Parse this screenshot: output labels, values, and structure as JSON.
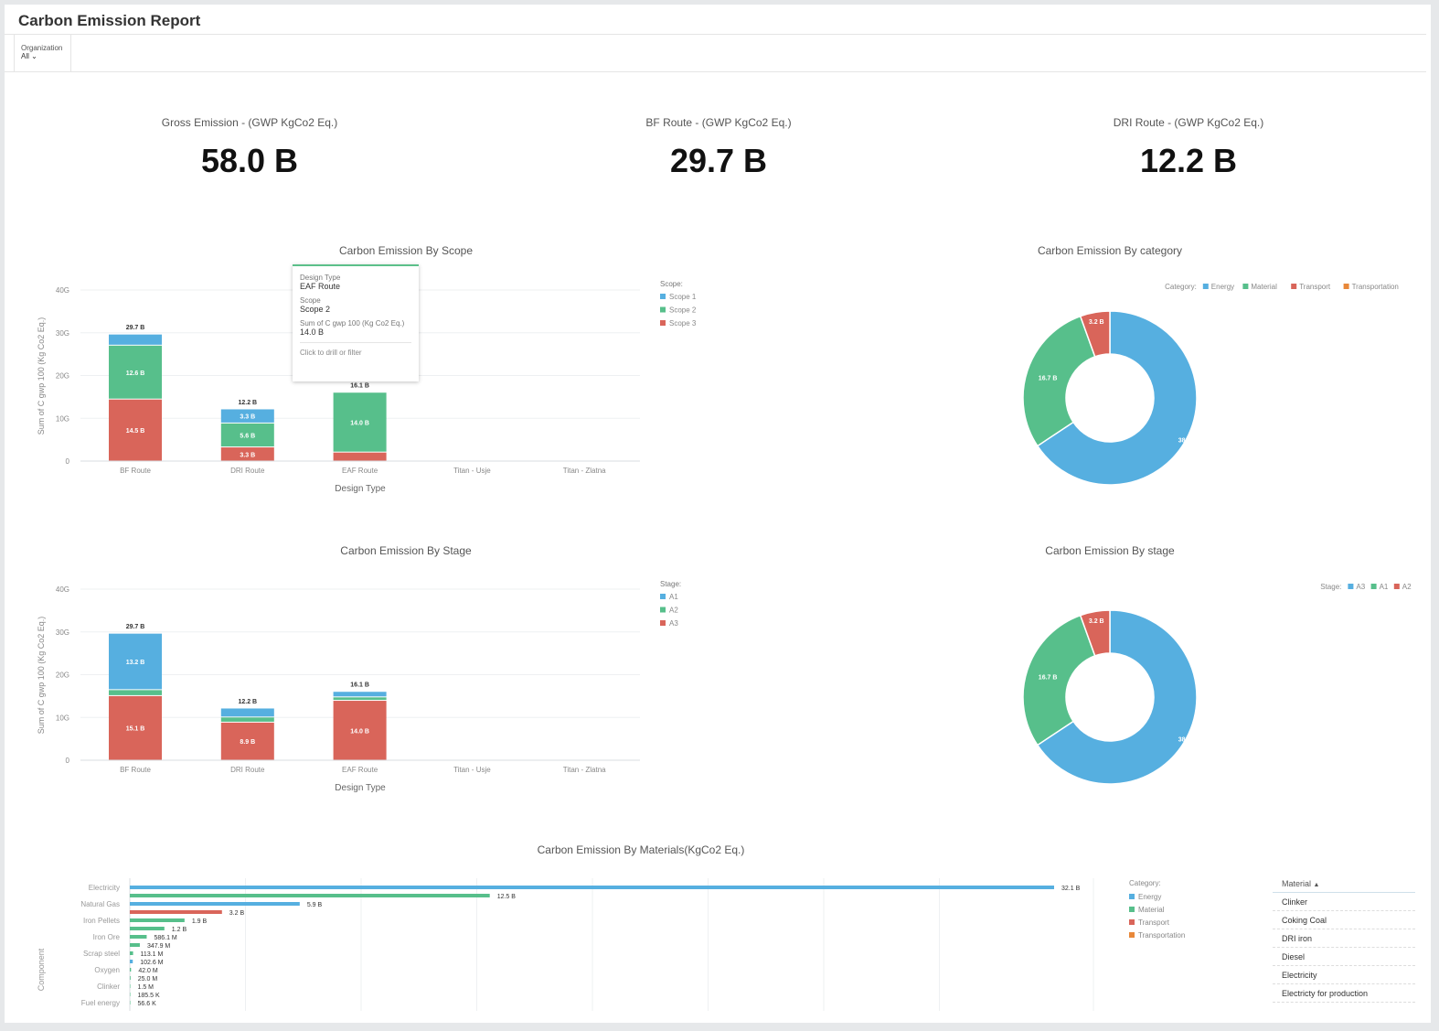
{
  "header": {
    "title": "Carbon Emission Report"
  },
  "filter": {
    "label": "Organization",
    "value": "All"
  },
  "kpis": [
    {
      "label": "Gross Emission - (GWP KgCo2 Eq.)",
      "value": "58.0 B"
    },
    {
      "label": "BF Route - (GWP KgCo2 Eq.)",
      "value": "29.7 B"
    },
    {
      "label": "DRI Route - (GWP KgCo2 Eq.)",
      "value": "12.2 B"
    }
  ],
  "colors": {
    "blue": "#56afe0",
    "green": "#57bf8b",
    "red": "#d9655a",
    "orange": "#e8883a"
  },
  "tooltip": {
    "k1": "Design Type",
    "v1": "EAF Route",
    "k2": "Scope",
    "v2": "Scope 2",
    "k3": "Sum of C gwp 100 (Kg Co2 Eq.)",
    "v3": "14.0 B",
    "footer": "Click to drill or filter"
  },
  "chart_data": [
    {
      "type": "bar",
      "stacked": true,
      "title": "Carbon Emission By Scope",
      "xlabel": "Design Type",
      "ylabel": "Sum of C gwp 100 (Kg Co2 Eq.)",
      "ylim": [
        0,
        40
      ],
      "yticks": [
        "0",
        "10G",
        "20G",
        "30G",
        "40G"
      ],
      "categories": [
        "BF Route",
        "DRI Route",
        "EAF Route",
        "Titan - Usje",
        "Titan - Zlatna"
      ],
      "legend_title": "Scope:",
      "totals": [
        "29.7 B",
        "12.2 B",
        "16.1 B",
        "",
        ""
      ],
      "series": [
        {
          "name": "Scope 3",
          "color": "red",
          "values": [
            14.5,
            3.3,
            2.1,
            0,
            0
          ],
          "labels": [
            "14.5 B",
            "3.3 B",
            "",
            "",
            ""
          ]
        },
        {
          "name": "Scope 2",
          "color": "green",
          "values": [
            12.6,
            5.6,
            14.0,
            0,
            0
          ],
          "labels": [
            "12.6 B",
            "5.6 B",
            "14.0 B",
            "",
            ""
          ]
        },
        {
          "name": "Scope 1",
          "color": "blue",
          "values": [
            2.6,
            3.3,
            0,
            0,
            0
          ],
          "labels": [
            "",
            "3.3 B",
            "",
            "",
            ""
          ]
        }
      ],
      "legend_order": [
        "Scope 1",
        "Scope 2",
        "Scope 3"
      ]
    },
    {
      "type": "pie",
      "donut": true,
      "title": "Carbon Emission By category",
      "legend_title": "Category:",
      "legend": [
        {
          "name": "Energy",
          "color": "blue"
        },
        {
          "name": "Material",
          "color": "green"
        },
        {
          "name": "Transport",
          "color": "red"
        },
        {
          "name": "Transportation",
          "color": "orange"
        }
      ],
      "slices": [
        {
          "name": "Energy",
          "value": 38.1,
          "label": "38.1 B",
          "color": "blue"
        },
        {
          "name": "Material",
          "value": 16.7,
          "label": "16.7 B",
          "color": "green"
        },
        {
          "name": "Transport",
          "value": 3.2,
          "label": "3.2 B",
          "color": "red"
        }
      ]
    },
    {
      "type": "bar",
      "stacked": true,
      "title": "Carbon Emission By Stage",
      "xlabel": "Design Type",
      "ylabel": "Sum of C gwp 100 (Kg Co2 Eq.)",
      "ylim": [
        0,
        40
      ],
      "yticks": [
        "0",
        "10G",
        "20G",
        "30G",
        "40G"
      ],
      "categories": [
        "BF Route",
        "DRI Route",
        "EAF Route",
        "Titan - Usje",
        "Titan - Zlatna"
      ],
      "legend_title": "Stage:",
      "totals": [
        "29.7 B",
        "12.2 B",
        "16.1 B",
        "",
        ""
      ],
      "series": [
        {
          "name": "A3",
          "color": "red",
          "values": [
            15.1,
            8.9,
            14.0,
            0,
            0
          ],
          "labels": [
            "15.1 B",
            "8.9 B",
            "14.0 B",
            "",
            ""
          ]
        },
        {
          "name": "A2",
          "color": "green",
          "values": [
            1.4,
            1.2,
            0.8,
            0,
            0
          ],
          "labels": [
            "",
            "",
            "",
            "",
            ""
          ]
        },
        {
          "name": "A1",
          "color": "blue",
          "values": [
            13.2,
            2.1,
            1.3,
            0,
            0
          ],
          "labels": [
            "13.2 B",
            "",
            "",
            "",
            ""
          ]
        }
      ],
      "legend_order": [
        "A1",
        "A2",
        "A3"
      ]
    },
    {
      "type": "pie",
      "donut": true,
      "title": "Carbon Emission By stage",
      "legend_title": "Stage:",
      "legend": [
        {
          "name": "A3",
          "color": "blue"
        },
        {
          "name": "A1",
          "color": "green"
        },
        {
          "name": "A2",
          "color": "red"
        }
      ],
      "slices": [
        {
          "name": "A3",
          "value": 38.1,
          "label": "38.1 B",
          "color": "blue"
        },
        {
          "name": "A1",
          "value": 16.7,
          "label": "16.7 B",
          "color": "green"
        },
        {
          "name": "A2",
          "value": 3.2,
          "label": "3.2 B",
          "color": "red"
        }
      ]
    },
    {
      "type": "bar",
      "horizontal": true,
      "title": "Carbon Emission By Materials(KgCo2 Eq.)",
      "ylabel": "Component",
      "legend_title": "Category:",
      "legend": [
        {
          "name": "Energy",
          "color": "blue"
        },
        {
          "name": "Material",
          "color": "green"
        },
        {
          "name": "Transport",
          "color": "red"
        },
        {
          "name": "Transportation",
          "color": "orange"
        }
      ],
      "category_labels": [
        "Electricity",
        "Natural Gas",
        "Iron Pellets",
        "Iron Ore",
        "Scrap steel",
        "Oxygen",
        "Clinker",
        "Fuel energy"
      ],
      "bars": [
        {
          "value": 32100000000,
          "label": "32.1 B",
          "color": "blue"
        },
        {
          "value": 12500000000,
          "label": "12.5 B",
          "color": "green"
        },
        {
          "value": 5900000000,
          "label": "5.9 B",
          "color": "blue"
        },
        {
          "value": 3200000000,
          "label": "3.2 B",
          "color": "red"
        },
        {
          "value": 1900000000,
          "label": "1.9 B",
          "color": "green"
        },
        {
          "value": 1200000000,
          "label": "1.2 B",
          "color": "green"
        },
        {
          "value": 586100000,
          "label": "586.1 M",
          "color": "green"
        },
        {
          "value": 347900000,
          "label": "347.9 M",
          "color": "green"
        },
        {
          "value": 113100000,
          "label": "113.1 M",
          "color": "green"
        },
        {
          "value": 102600000,
          "label": "102.6 M",
          "color": "blue"
        },
        {
          "value": 42000000,
          "label": "42.0 M",
          "color": "green"
        },
        {
          "value": 25000000,
          "label": "25.0 M",
          "color": "green"
        },
        {
          "value": 1500000,
          "label": "1.5 M",
          "color": "green"
        },
        {
          "value": 185500,
          "label": "185.5 K",
          "color": "green"
        },
        {
          "value": 56600,
          "label": "56.6 K",
          "color": "green"
        }
      ]
    }
  ],
  "table": {
    "header": "Material",
    "rows": [
      "Clinker",
      "Coking Coal",
      "DRI iron",
      "Diesel",
      "Electricity",
      "Electricty for production"
    ]
  }
}
